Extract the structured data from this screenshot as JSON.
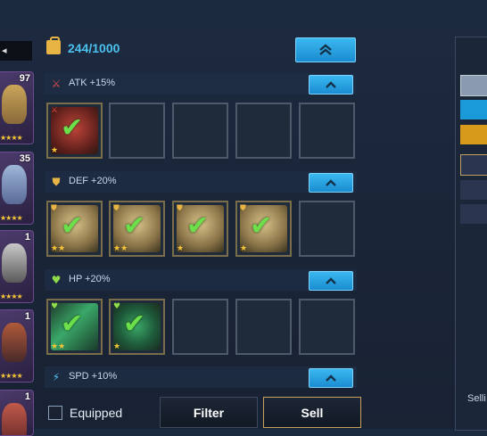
{
  "inventory": {
    "count": "244/1000"
  },
  "heroes": [
    {
      "level": "97",
      "stars": "★★★★"
    },
    {
      "level": "35",
      "stars": "★★★★"
    },
    {
      "level": "1",
      "stars": "★★★★"
    },
    {
      "level": "1",
      "stars": "★★★★"
    },
    {
      "level": "1",
      "stars": ""
    }
  ],
  "sections": [
    {
      "label": "ATK +15%",
      "icon": "sword-icon",
      "color": "#e34a4a"
    },
    {
      "label": "DEF +20%",
      "icon": "shield-icon",
      "color": "#e8b545"
    },
    {
      "label": "HP +20%",
      "icon": "heart-icon",
      "color": "#8fdc4a"
    },
    {
      "label": "SPD +10%",
      "icon": "boot-icon",
      "color": "#4cc2ef"
    }
  ],
  "bottom": {
    "equipped_label": "Equipped",
    "filter_label": "Filter",
    "sell_label": "Sell"
  },
  "right_panel": {
    "text": "Selli"
  },
  "colors": {
    "accent": "#3bb8f0",
    "check": "#6ce04a",
    "gold": "#e8b545"
  }
}
